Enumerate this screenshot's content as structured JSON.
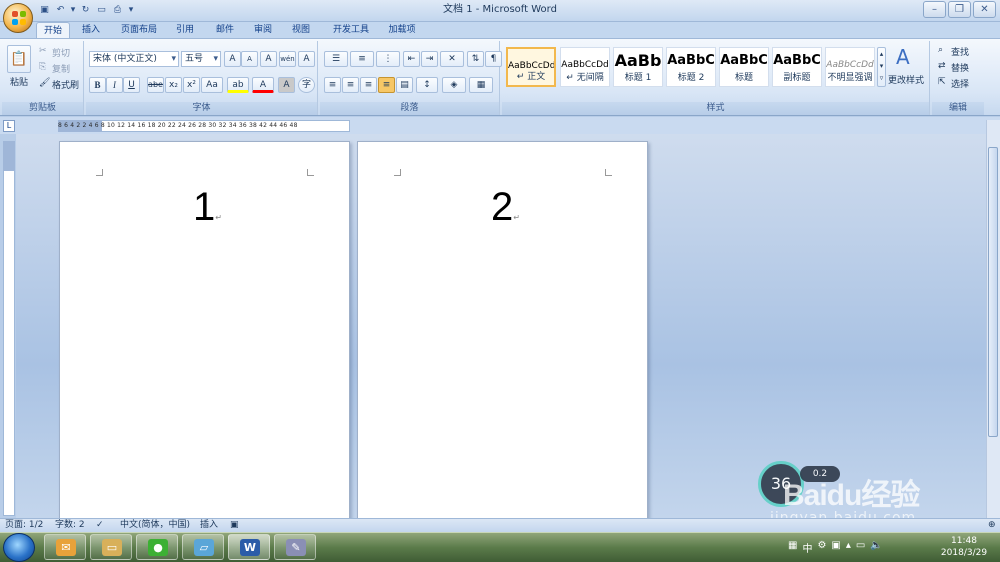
{
  "window": {
    "title": "文档 1 - Microsoft Word"
  },
  "quick_access": [
    "save",
    "undo",
    "redo",
    "new",
    "print-preview",
    "customize"
  ],
  "tabs": [
    {
      "label": "开始",
      "active": true
    },
    {
      "label": "插入"
    },
    {
      "label": "页面布局"
    },
    {
      "label": "引用"
    },
    {
      "label": "邮件"
    },
    {
      "label": "审阅"
    },
    {
      "label": "视图"
    },
    {
      "label": "开发工具"
    },
    {
      "label": "加载项"
    }
  ],
  "clipboard": {
    "group": "剪贴板",
    "paste": "粘贴",
    "cut": "剪切",
    "copy": "复制",
    "format_painter": "格式刷"
  },
  "font": {
    "group": "字体",
    "name": "宋体 (中文正文)",
    "size": "五号",
    "bold": "B",
    "italic": "I",
    "underline": "U",
    "strikethrough": "abe",
    "subscript": "x₂",
    "superscript": "x²",
    "change_case": "Aa",
    "grow": "A",
    "shrink": "A",
    "clear_format": "A",
    "phonetic": "wén",
    "char_border": "A",
    "highlight": "ab",
    "font_color": "A",
    "char_shading": "A",
    "enclose": "字"
  },
  "paragraph": {
    "group": "段落"
  },
  "styles": {
    "group": "样式",
    "items": [
      {
        "preview": "AaBbCcDd",
        "name": "↵ 正文",
        "selected": true
      },
      {
        "preview": "AaBbCcDd",
        "name": "↵ 无间隔"
      },
      {
        "preview": "AaBb",
        "name": "标题 1"
      },
      {
        "preview": "AaBbC",
        "name": "标题 2"
      },
      {
        "preview": "AaBbC",
        "name": "标题"
      },
      {
        "preview": "AaBbC",
        "name": "副标题"
      },
      {
        "preview": "AaBbCcDd",
        "name": "不明显强调"
      }
    ],
    "change_styles": "更改样式"
  },
  "editing": {
    "group": "编辑",
    "find": "查找",
    "replace": "替换",
    "select": "选择"
  },
  "ruler": {
    "ticks": "8  6  4  2  2  4  6  8  10  12  14  16  18  20  22  24  26  28  30  32  34  36  38  42  44  46  48"
  },
  "pages": [
    {
      "number": "1",
      "mark": "↵"
    },
    {
      "number": "2",
      "mark": "↵"
    }
  ],
  "status": {
    "page": "页面: 1/2",
    "words": "字数: 2",
    "language": "中文(简体，中国)",
    "mode": "插入"
  },
  "overlay": {
    "speed": "36",
    "speed_small": "0.2",
    "watermark": "Baidu经验",
    "watermark_url": "jingyan.baidu.com"
  },
  "taskbar": {
    "ime": "中",
    "time": "11:48",
    "date": "2018/3/29"
  },
  "colors": {
    "accent": "#15428b",
    "highlight": "#ffff00",
    "font_color": "#ff0000"
  }
}
